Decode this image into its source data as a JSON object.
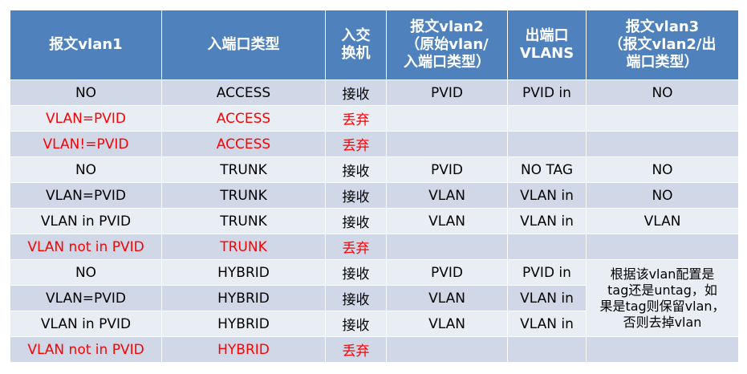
{
  "colors": {
    "header_bg": "#4f81bd",
    "row_dark": "#d0d8e8",
    "row_light": "#e9edf4",
    "drop_text": "#ff0000"
  },
  "headers": [
    [
      "报文vlan1"
    ],
    [
      "入端口类型"
    ],
    [
      "入交",
      "换机"
    ],
    [
      "报文vlan2",
      "（原始vlan/",
      "入端口类型）"
    ],
    [
      "出端口",
      "VLANS"
    ],
    [
      "报文vlan3",
      "（报文vlan2/出",
      "端口类型）"
    ]
  ],
  "rows": [
    [
      "NO",
      "ACCESS",
      "接收",
      "PVID",
      "PVID in",
      "NO"
    ],
    [
      "VLAN=PVID",
      "ACCESS",
      "丢弃",
      "",
      "",
      ""
    ],
    [
      "VLAN!=PVID",
      "ACCESS",
      "丢弃",
      "",
      "",
      ""
    ],
    [
      "NO",
      "TRUNK",
      "接收",
      "PVID",
      "NO TAG",
      "NO"
    ],
    [
      "VLAN=PVID",
      "TRUNK",
      "接收",
      "VLAN",
      "VLAN in",
      "NO"
    ],
    [
      "VLAN in PVID",
      "TRUNK",
      "接收",
      "VLAN",
      "VLAN in",
      "VLAN"
    ],
    [
      "VLAN not in PVID",
      "TRUNK",
      "丢弃",
      "",
      "",
      ""
    ],
    [
      "NO",
      "HYBRID",
      "接收",
      "PVID",
      "PVID in",
      ""
    ],
    [
      "VLAN=PVID",
      "HYBRID",
      "接收",
      "VLAN",
      "VLAN in",
      ""
    ],
    [
      "VLAN in PVID",
      "HYBRID",
      "接收",
      "VLAN",
      "VLAN in",
      ""
    ],
    [
      "VLAN not in PVID",
      "HYBRID",
      "丢弃",
      "",
      "",
      ""
    ]
  ],
  "hybrid_note": [
    "根据该vlan配置是",
    "tag还是untag，如",
    "果是tag则保留vlan，",
    "否则去掉vlan"
  ]
}
